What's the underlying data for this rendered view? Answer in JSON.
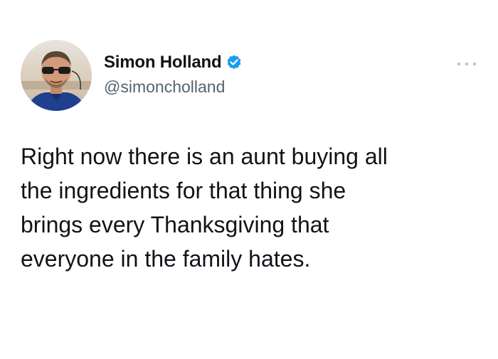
{
  "author": {
    "display_name": "Simon Holland",
    "handle": "@simoncholland",
    "verified": true,
    "avatar_icon": "profile-photo",
    "verified_icon": "verified-badge-icon",
    "verified_color": "#1d9bf0"
  },
  "menu": {
    "icon": "more-options-icon"
  },
  "tweet": {
    "lines": [
      "Right now there is an aunt buying all",
      "the ingredients for that thing she",
      "brings every Thanksgiving that",
      "everyone in the family hates."
    ]
  },
  "colors": {
    "text": "#0f1419",
    "handle": "#536471",
    "background": "#ffffff"
  }
}
